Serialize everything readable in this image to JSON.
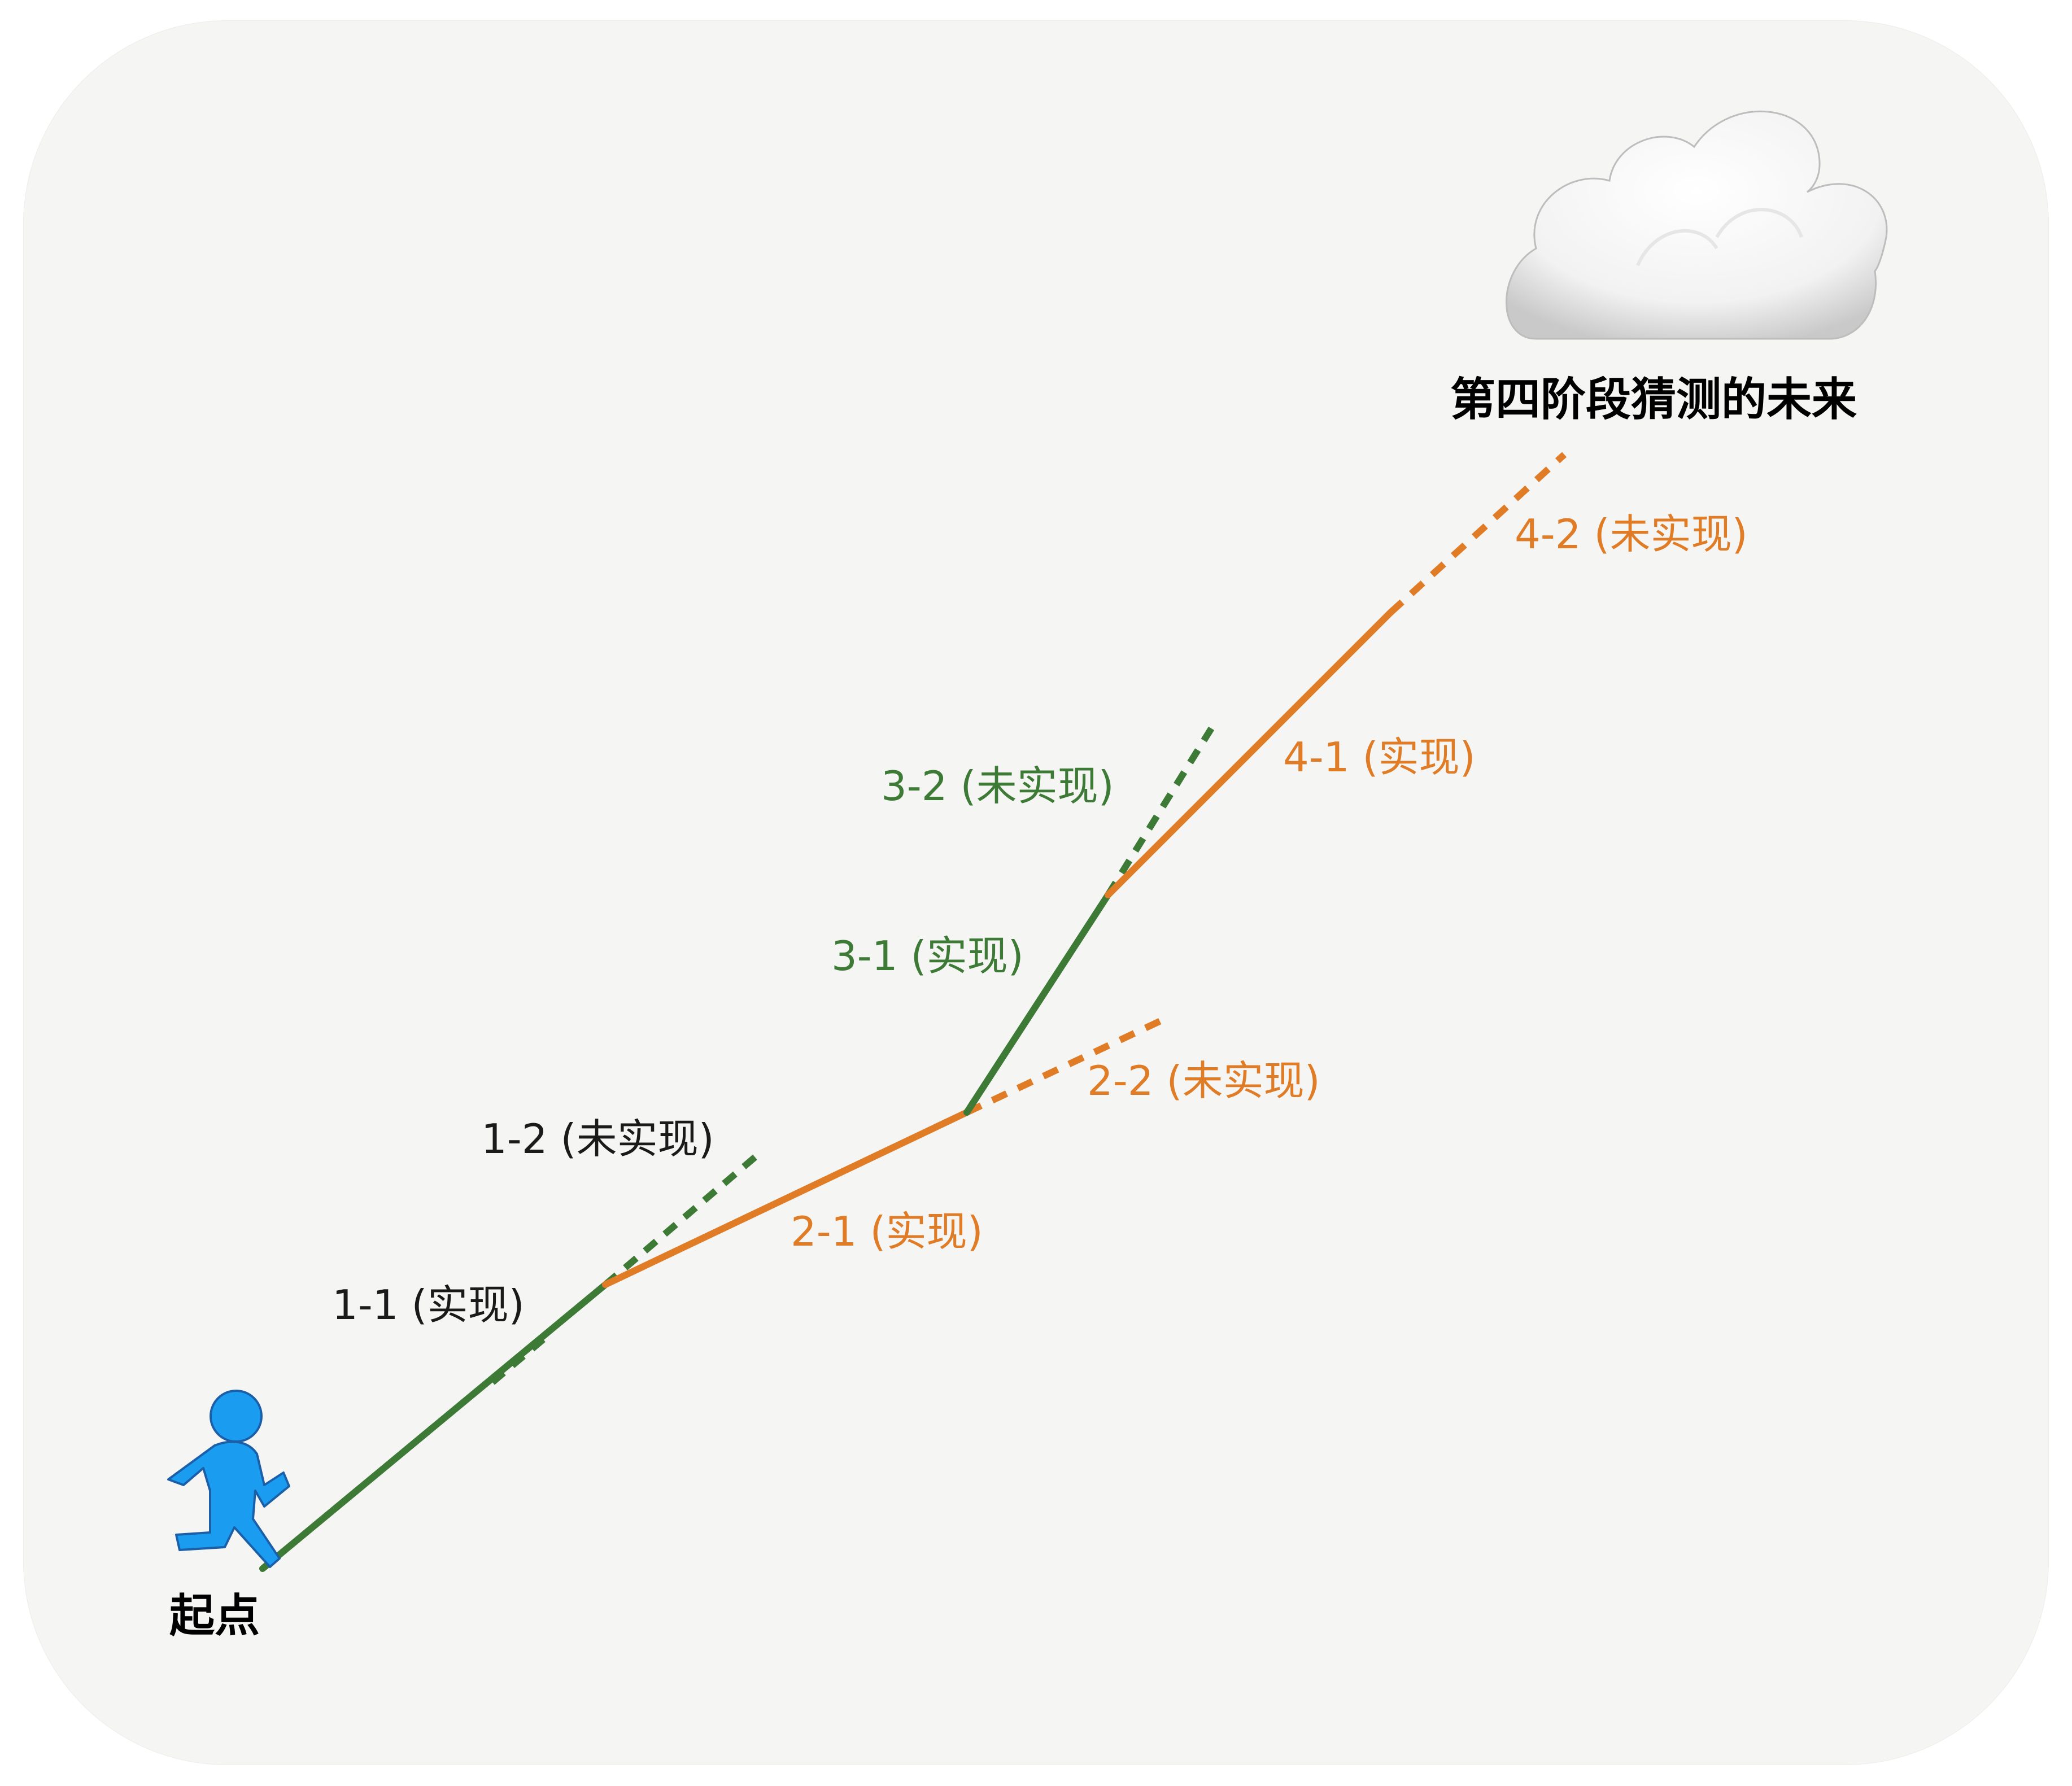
{
  "colors": {
    "green": "#3d7a36",
    "orange": "#e07b26",
    "black": "#1a1a1a",
    "runner": "#1a9cf0",
    "background": "#f5f5f3"
  },
  "icons": {
    "runner": "person-running-icon",
    "cloud": "cloud-icon"
  },
  "labels": {
    "start": "起点",
    "future": "第四阶段猜测的未来",
    "seg_1_1": "1-1 (实现)",
    "seg_1_2": "1-2 (未实现)",
    "seg_2_1": "2-1 (实现)",
    "seg_2_2": "2-2 (未实现)",
    "seg_3_1": "3-1 (实现)",
    "seg_3_2": "3-2 (未实现)",
    "seg_4_1": "4-1 (实现)",
    "seg_4_2": "4-2 (未实现)"
  }
}
